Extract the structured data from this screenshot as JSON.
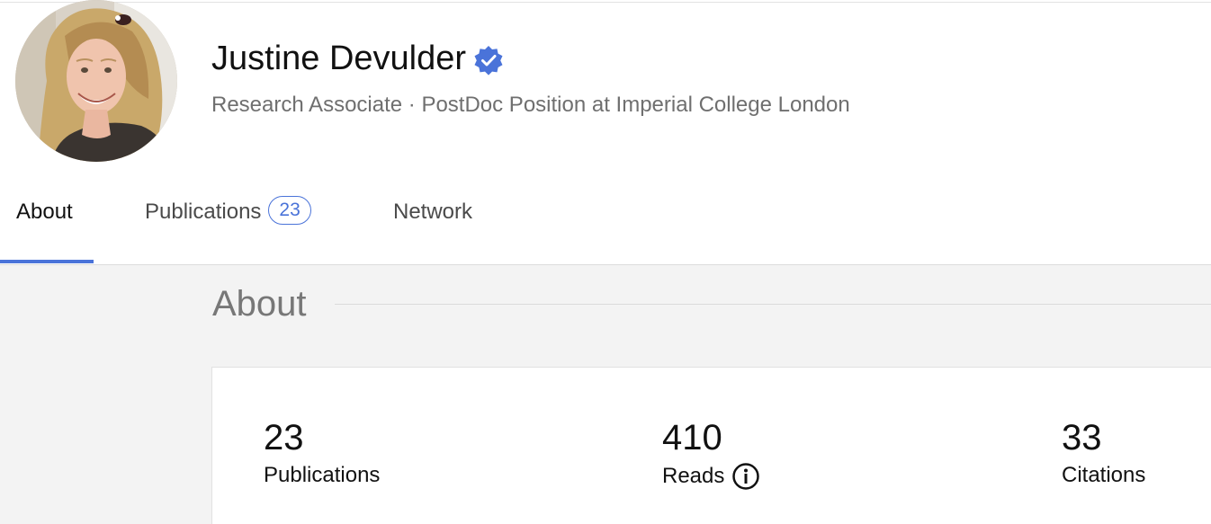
{
  "profile": {
    "name": "Justine Devulder",
    "subtitle": "Research Associate · PostDoc Position at Imperial College London",
    "verified": true
  },
  "tabs": [
    {
      "label": "About",
      "active": true
    },
    {
      "label": "Publications",
      "badge": "23"
    },
    {
      "label": "Network"
    }
  ],
  "about": {
    "title": "About"
  },
  "stats": [
    {
      "value": "23",
      "label": "Publications"
    },
    {
      "value": "410",
      "label": "Reads",
      "icon": "info-icon"
    },
    {
      "value": "33",
      "label": "Citations"
    }
  ],
  "colors": {
    "accent": "#4a73d9",
    "content_bg": "#f3f3f3",
    "subtitle_text": "#6f6f6f"
  }
}
